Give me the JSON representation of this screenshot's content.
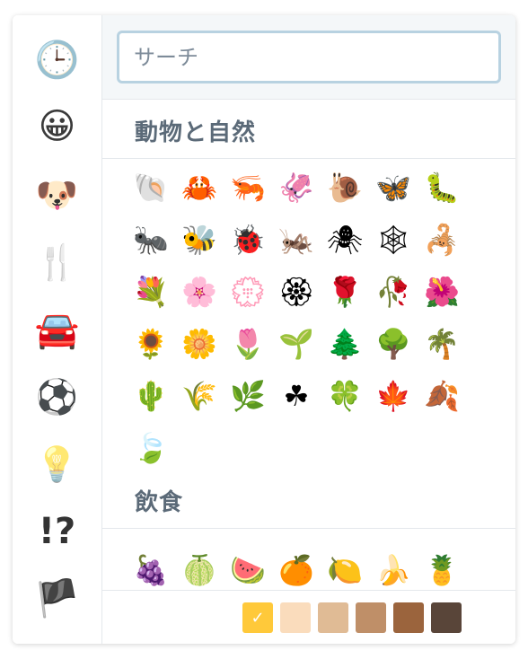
{
  "sidebar": {
    "categories": [
      {
        "name": "recent",
        "icon": "clock-icon",
        "glyph": "🕒"
      },
      {
        "name": "smileys",
        "icon": "grinning-face-icon",
        "glyph": "😀"
      },
      {
        "name": "animals-nature",
        "icon": "dog-face-icon",
        "glyph": "🐶"
      },
      {
        "name": "food-drink",
        "icon": "fork-knife-icon",
        "glyph": "🍴"
      },
      {
        "name": "travel",
        "icon": "car-icon",
        "glyph": "🚘"
      },
      {
        "name": "activities",
        "icon": "soccer-ball-icon",
        "glyph": "⚽"
      },
      {
        "name": "objects",
        "icon": "light-bulb-icon",
        "glyph": "💡"
      },
      {
        "name": "symbols",
        "icon": "interrobang-icon",
        "glyph": "!?"
      },
      {
        "name": "flags",
        "icon": "flag-icon",
        "glyph": "🏴"
      }
    ]
  },
  "search": {
    "placeholder": "サーチ",
    "value": ""
  },
  "sections": [
    {
      "title": "動物と自然",
      "emojis": [
        "🐚",
        "🦀",
        "🦐",
        "🦑",
        "🐌",
        "🦋",
        "🐛",
        "🐜",
        "🐝",
        "🐞",
        "🦗",
        "🕷",
        "🕸",
        "🦂",
        "💐",
        "🌸",
        "💮",
        "🏵",
        "🌹",
        "🥀",
        "🌺",
        "🌻",
        "🌼",
        "🌷",
        "🌱",
        "🌲",
        "🌳",
        "🌴",
        "🌵",
        "🌾",
        "🌿",
        "☘",
        "🍀",
        "🍁",
        "🍂",
        "🍃"
      ]
    },
    {
      "title": "飲食",
      "emojis": [
        "🍇",
        "🍈",
        "🍉",
        "🍊",
        "🍋",
        "🍌",
        "🍍"
      ]
    }
  ],
  "skin_tones": {
    "selected_mark": "✓",
    "colors": [
      "#ffc93a",
      "#fadcbc",
      "#e0bb95",
      "#bf8f68",
      "#9b643d",
      "#594539"
    ]
  }
}
